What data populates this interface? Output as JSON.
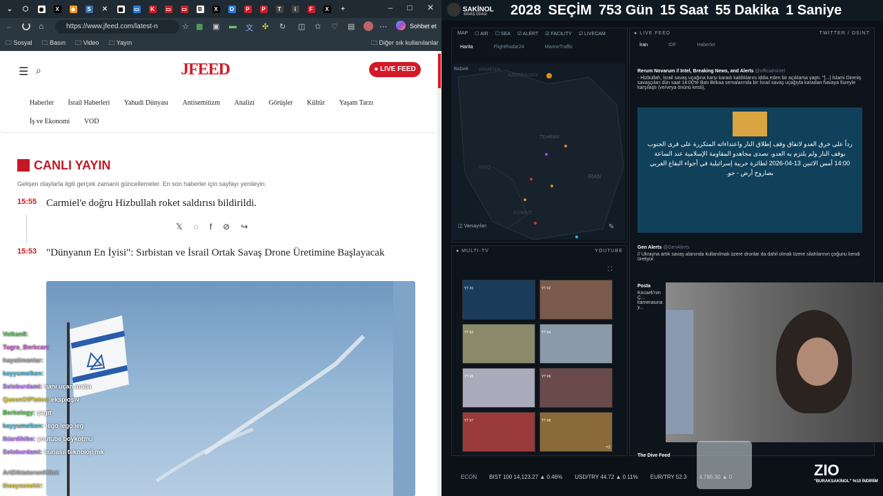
{
  "browser": {
    "url": "https://www.jfeed.com/latest-n",
    "bookmarks": [
      "Sosyal",
      "Basın",
      "Video",
      "Yayın"
    ],
    "other_bookmarks": "Diğer sık kullanılanlar",
    "chat_button": "Sohbet et"
  },
  "site": {
    "logo": "JFEED",
    "live_button": "LIVE FEED",
    "nav": [
      "Haberler",
      "İsrail Haberleri",
      "Yahudi Dünyası",
      "Antisemitizm",
      "Analizi",
      "Görüşler",
      "Kültür",
      "Yaşam Tarzı",
      "İş ve Ekonomi",
      "VOD"
    ],
    "live_title": "CANLI YAYIN",
    "live_desc": "Gelişen olaylarla ilgili gerçek zamanlı güncellemeler. En son haberler için sayfayı yenileyin.",
    "items": [
      {
        "time": "15:55",
        "headline": "Carmiel'e doğru Hizbullah roket saldırısı bildirildi."
      },
      {
        "time": "15:53",
        "headline": "\"Dünyanın En İyisi\": Sırbistan ve İsrail Ortak Savaş Drone Üretimine Başlayacak"
      }
    ]
  },
  "chat": [
    {
      "user": "Volkan8:",
      "msg": ""
    },
    {
      "user": "Tugra_Berkcan:",
      "msg": ""
    },
    {
      "user": "hayatimantar:",
      "msg": ""
    },
    {
      "user": "kayyumelken:",
      "msg": ""
    },
    {
      "user": "Seloburdami:",
      "msg": "hani uçan araba"
    },
    {
      "user": "QueenOfPlates:",
      "msg": "eksploşiv"
    },
    {
      "user": "Berkology:",
      "msg": "şagıt"
    },
    {
      "user": "kayyumelken:",
      "msg": "lego lego leg"
    },
    {
      "user": "Ikiardikibe:",
      "msg": "youtube boykotmu"
    },
    {
      "user": "Seloburdami:",
      "msg": "bunasıl teknoloji mk"
    },
    {
      "user": "ArtDiktatorunKilici:",
      "msg": ""
    },
    {
      "user": "theaysenehir:",
      "msg": ""
    }
  ],
  "stream": {
    "brand": "SAKİNOL",
    "brand_sub": "SAVAŞ ODASI",
    "countdown": [
      "2028",
      "SEÇİM",
      "753 Gün",
      "15 Saat",
      "55 Dakika",
      "1 Saniye"
    ],
    "map_filters": [
      "AIR",
      "SEA",
      "ALERT",
      "FACILITY",
      "LIVECAM"
    ],
    "map_title": "MAP",
    "map_tabs": [
      "Harita",
      "FlightRadar24",
      "MarineTraffic"
    ],
    "map_reset": "Varsayılan",
    "map_labels": [
      "ARMENIA",
      "AZERBAIJAN",
      "TEHRAN",
      "IRAN",
      "IRAQ",
      "KUWAIT"
    ],
    "radar": "RADAR",
    "live_feed": "LIVE FEED",
    "feed_sources": "TWITTER / OSINT",
    "feed_tabs": [
      "İran",
      "IDF",
      "Haberler"
    ],
    "feed": [
      {
        "src": "Rerum Novarum // Intel, Breaking News, and Alerts",
        "handle": "@officialnintel",
        "text": "- Hizbullah, İsrail savaş uçağına karşı karadı kaldıklarını iddia eden bir açıklama yaptı. \"[...] İslami Direniş savaşçıları dün saat 14:00'te Batı Bekaa semalarında bir İsrail savaş uçağıyla karadan havaya füzeyle karşılaştı (ve/veya önünü kesti),"
      },
      {
        "src": "Gen Alerts",
        "handle": "@GenAlerts",
        "text": "// Ukrayna artık savaş alanında kullanılmak üzere dronlar da dahil olmak üzere silahlarının çoğunu kendi üretiyor."
      },
      {
        "src": "Posta",
        "handle": "",
        "text": "Kocaeli'nin Ç... kamerasına y..."
      },
      {
        "src": "The Dive Feed",
        "handle": "",
        "text": ""
      }
    ],
    "arabic_text": "رداً على خرق العدو لاتفاق وقف إطلاق النار واعتداءاته المتكررة على قرى الجنوب بوقف النار ولم يلتزم به العدو، تصدى مجاهدو المقاومة الإسلامية عند الساعة 14:00 أمس الاثنين 13-04-2026 لطائرة حربية إسرائيلية في أجواء البقاع الغربي بصاروخ أرض - جو.",
    "multi_tv": "MULTI-TV",
    "tv_source": "YOUTUBE",
    "tv_labels": [
      "YT #1",
      "YT #2",
      "YT #3",
      "YT #4",
      "YT #5",
      "YT #6",
      "YT #7",
      "YT #8"
    ],
    "tv_more": "+2",
    "econ_label": "ECON",
    "econ": [
      "BIST 100 14,123.27 ▲ 0.46%",
      "USD/TRY 44.72 ▲ 0.11%",
      "EUR/TRY 52.3",
      "4,786.30 ▲ 0"
    ],
    "promo_brand": "ZIO",
    "promo_text": "\"BURAKSAKİNOL\" %10 İNDİRİM",
    "webcam_caption": "ZIO"
  },
  "colors": {
    "accent": "#d31a27",
    "dark_bg": "#0b1117",
    "brand_blue": "#2a7bd8"
  }
}
